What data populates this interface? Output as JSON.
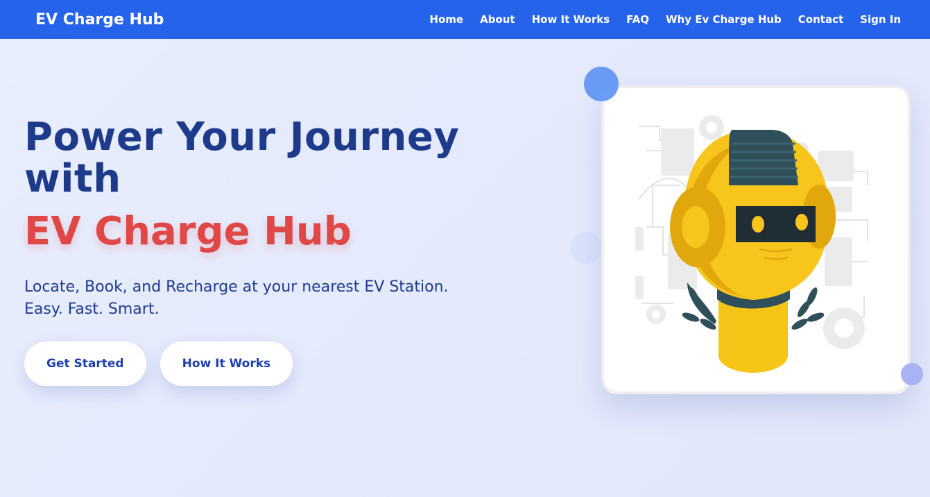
{
  "navbar": {
    "brand": "EV Charge Hub",
    "links": [
      "Home",
      "About",
      "How It Works",
      "FAQ",
      "Why Ev Charge Hub",
      "Contact",
      "Sign In"
    ]
  },
  "hero": {
    "title_line1": "Power Your Journey",
    "title_line2": "with",
    "title_accent": "EV Charge Hub",
    "subtitle_line1": "Locate, Book, and Recharge at your nearest EV Station.",
    "subtitle_line2": "Easy. Fast. Smart.",
    "buttons": {
      "primary": "Get Started",
      "secondary": "How It Works"
    }
  },
  "illustration": {
    "icon": "robot-head-illustration"
  },
  "colors": {
    "navbar": "#2563eb",
    "heading": "#1e3a8a",
    "accent": "#e04848",
    "button_text": "#1e40af"
  }
}
